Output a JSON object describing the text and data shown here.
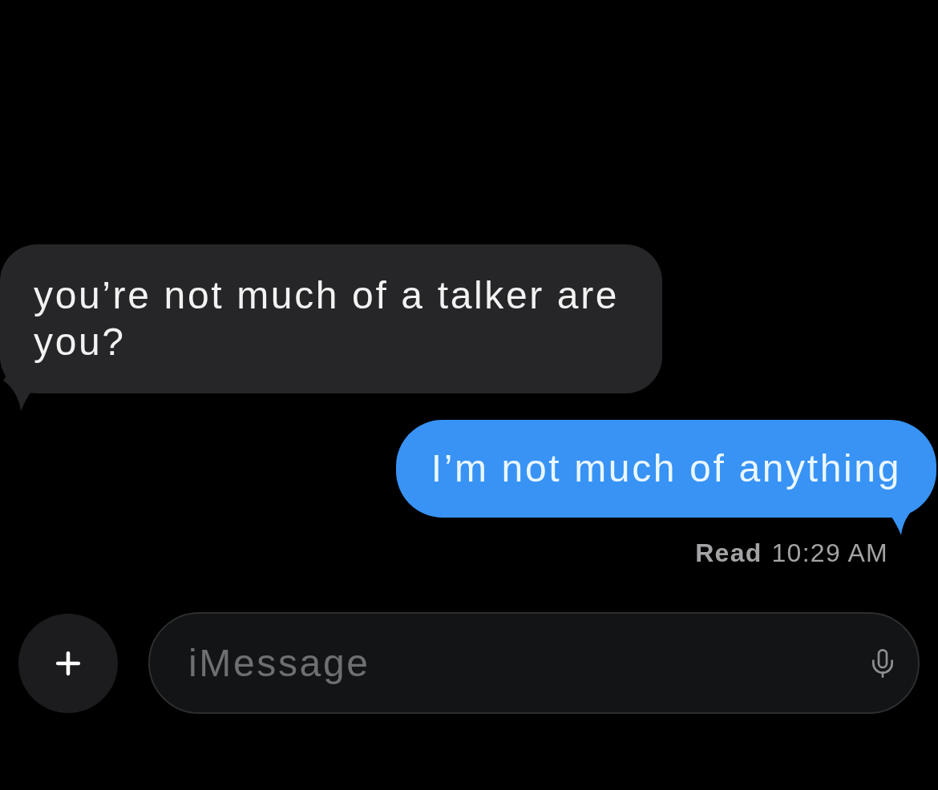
{
  "messages": [
    {
      "kind": "received",
      "text": "you’re not much of a talker are you?"
    },
    {
      "kind": "sent",
      "text": "I’m not much of anything"
    }
  ],
  "receipt": {
    "status": "Read",
    "time": "10:29 AM"
  },
  "composer": {
    "placeholder": "iMessage"
  }
}
